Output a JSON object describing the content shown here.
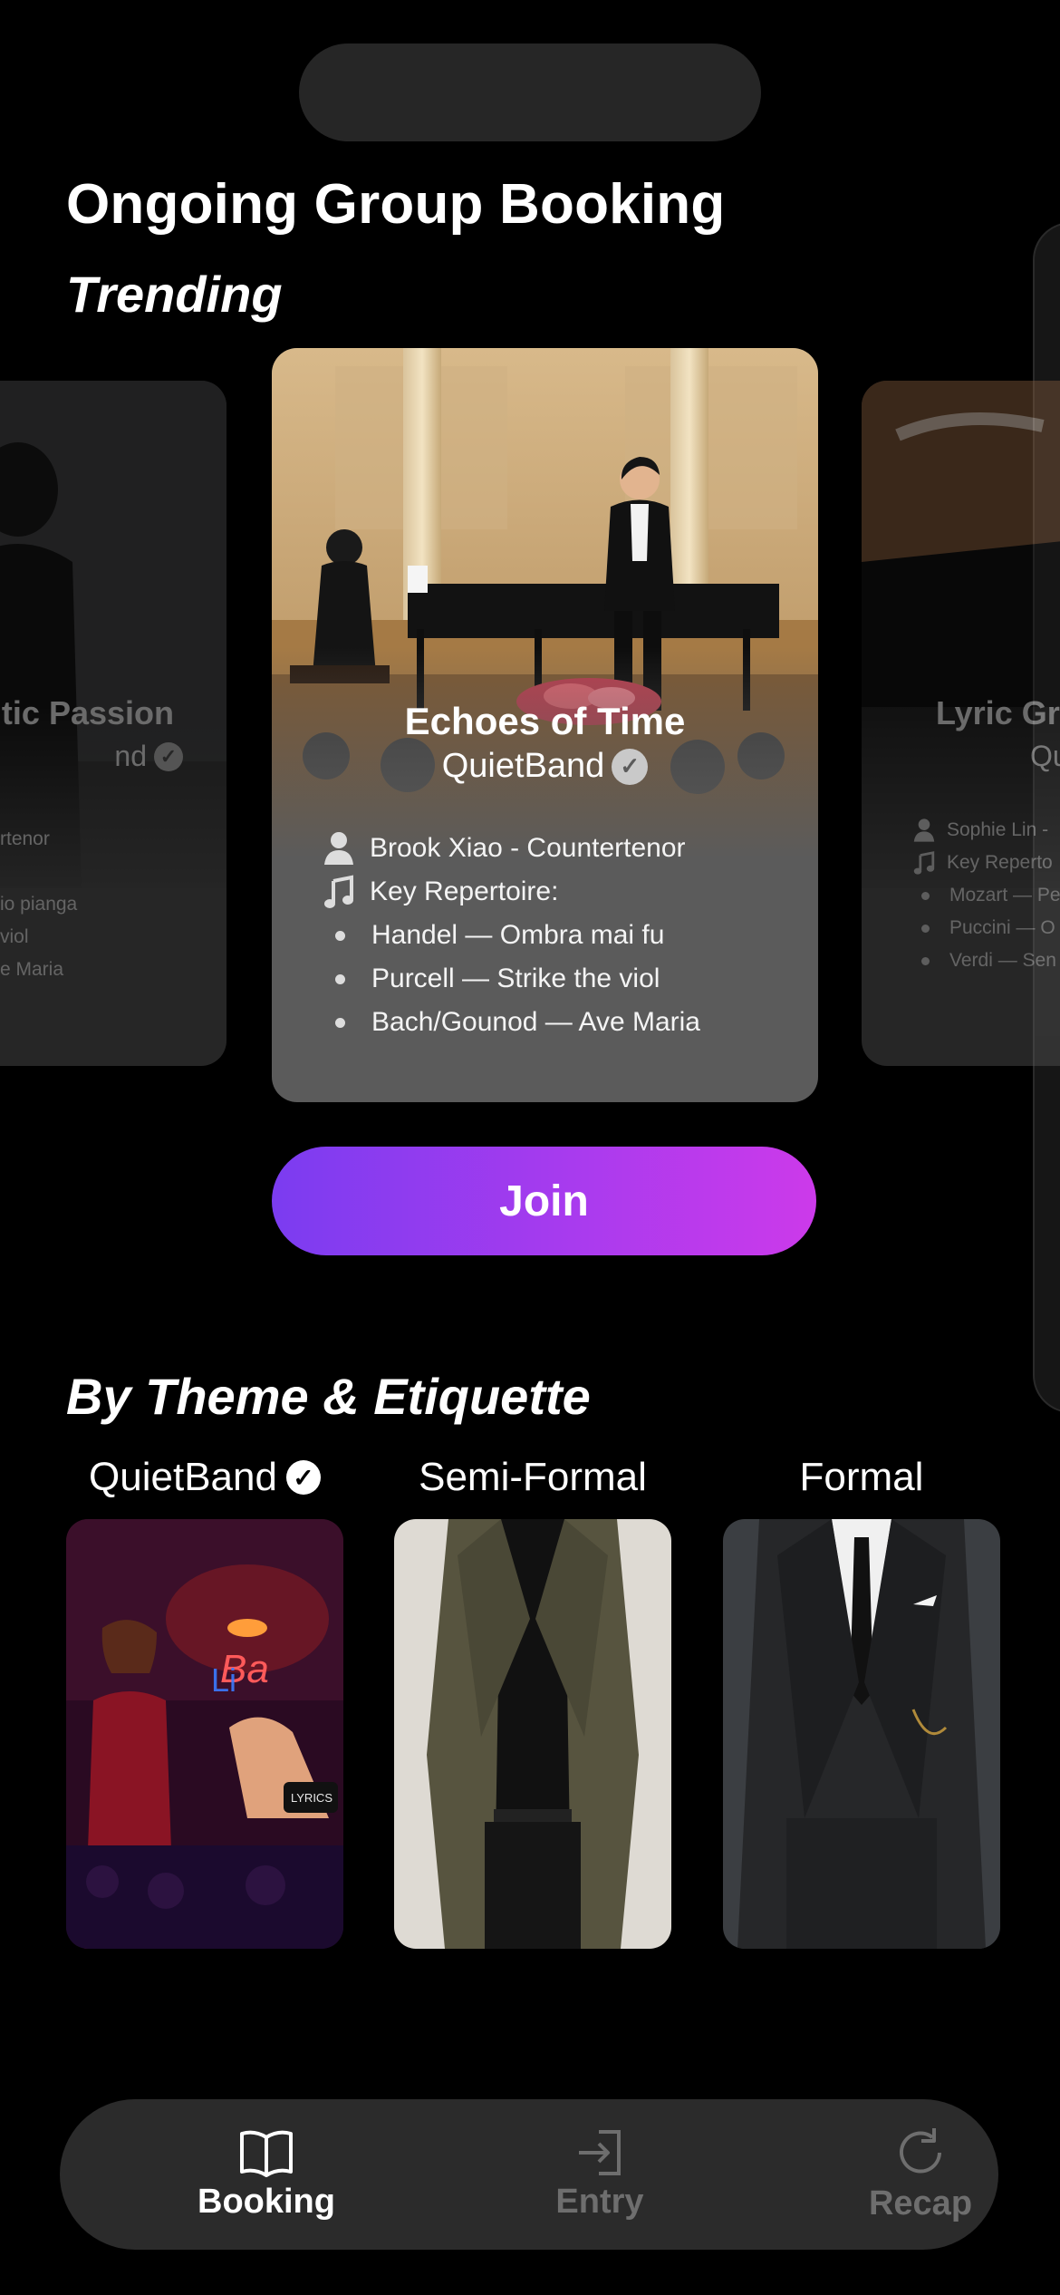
{
  "header": {
    "title": "Ongoing Group Booking"
  },
  "trending": {
    "heading": "Trending",
    "left_card": {
      "title": "ntic Passion",
      "band": "nd",
      "lines": [
        "rtenor",
        "io pianga",
        "viol",
        "e Maria"
      ]
    },
    "center_card": {
      "title": "Echoes of Time",
      "band": "QuietBand",
      "performer": "Brook Xiao - Countertenor",
      "repertoire_label": "Key Repertoire:",
      "pieces": [
        "Handel — Ombra mai fu",
        "Purcell — Strike the viol",
        "Bach/Gounod — Ave Maria"
      ]
    },
    "right_card": {
      "title": "Lyric Gra",
      "band": "Qu",
      "performer": "Sophie Lin -",
      "repertoire_label": "Key Reperto",
      "pieces": [
        "Mozart — Pe",
        "Puccini — O",
        "Verdi — Sen"
      ]
    },
    "join_label": "Join"
  },
  "themes": {
    "heading": "By Theme & Etiquette",
    "items": [
      {
        "label": "QuietBand",
        "verified": true
      },
      {
        "label": "Semi-Formal"
      },
      {
        "label": "Formal"
      }
    ],
    "wristband_text": "LYRICS"
  },
  "tabbar": {
    "tabs": [
      {
        "label": "Booking",
        "icon": "book-icon",
        "active": true
      },
      {
        "label": "Entry",
        "icon": "enter-icon",
        "active": false
      },
      {
        "label": "Recap",
        "icon": "refresh-icon",
        "active": false
      }
    ],
    "active_color": "#ffffff",
    "inactive_color": "#6e6e6e"
  },
  "colors": {
    "background": "#000000",
    "join_gradient_start": "#7b3cf0",
    "join_gradient_end": "#cc3aea",
    "card": "#5b5b5b"
  }
}
